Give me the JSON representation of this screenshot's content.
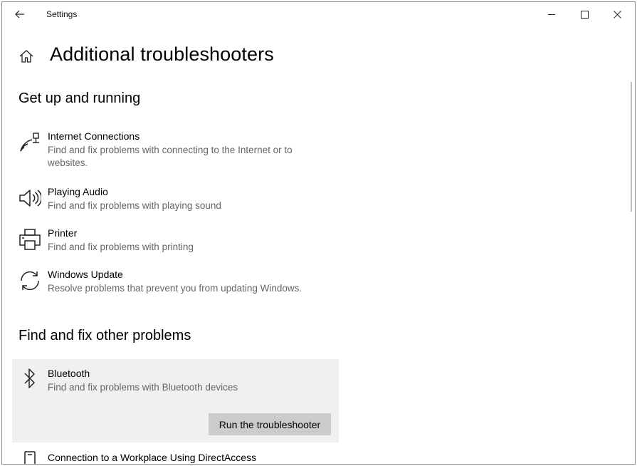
{
  "window": {
    "title": "Settings",
    "controls": {
      "minimize": "minimize-icon",
      "maximize": "maximize-icon",
      "close": "close-icon"
    }
  },
  "header": {
    "title": "Additional troubleshooters",
    "home_icon": "home-icon",
    "back_icon": "back-arrow-icon"
  },
  "sections": {
    "get_up": {
      "title": "Get up and running",
      "items": [
        {
          "name": "Internet Connections",
          "desc": "Find and fix problems with connecting to the Internet or to websites.",
          "icon": "network-icon"
        },
        {
          "name": "Playing Audio",
          "desc": "Find and fix problems with playing sound",
          "icon": "speaker-icon"
        },
        {
          "name": "Printer",
          "desc": "Find and fix problems with printing",
          "icon": "printer-icon"
        },
        {
          "name": "Windows Update",
          "desc": "Resolve problems that prevent you from updating Windows.",
          "icon": "sync-icon"
        }
      ]
    },
    "other": {
      "title": "Find and fix other problems",
      "items": [
        {
          "name": "Bluetooth",
          "desc": "Find and fix problems with Bluetooth devices",
          "icon": "bluetooth-icon",
          "button": "Run the troubleshooter"
        },
        {
          "name": "Connection to a Workplace Using DirectAccess",
          "icon": "device-icon"
        }
      ]
    }
  }
}
